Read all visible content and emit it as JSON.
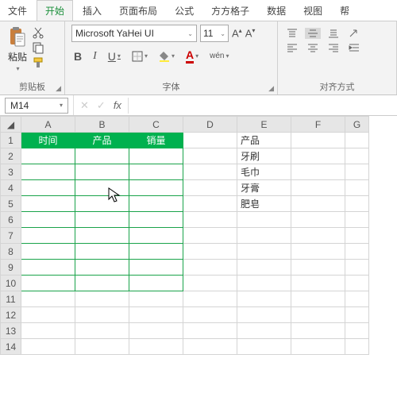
{
  "menu": {
    "file": "文件",
    "home": "开始",
    "insert": "插入",
    "layout": "页面布局",
    "formula": "公式",
    "ffgz": "方方格子",
    "data": "数据",
    "view": "视图",
    "help": "帮"
  },
  "ribbon": {
    "clipboard": {
      "paste": "粘贴",
      "label": "剪贴板"
    },
    "font": {
      "name": "Microsoft YaHei UI",
      "size": "11",
      "label": "字体",
      "bold": "B",
      "italic": "I",
      "underline": "U",
      "wen": "wén"
    },
    "align": {
      "label": "对齐方式"
    }
  },
  "namebox": "M14",
  "fx": "fx",
  "cols": [
    "A",
    "B",
    "C",
    "D",
    "E",
    "F",
    "G"
  ],
  "rows": [
    "1",
    "2",
    "3",
    "4",
    "5",
    "6",
    "7",
    "8",
    "9",
    "10",
    "11",
    "12",
    "13",
    "14"
  ],
  "headers": {
    "a": "时间",
    "b": "产品",
    "c": "销量"
  },
  "ecol": {
    "1": "产品",
    "2": "牙刷",
    "3": "毛巾",
    "4": "牙膏",
    "5": "肥皂"
  }
}
